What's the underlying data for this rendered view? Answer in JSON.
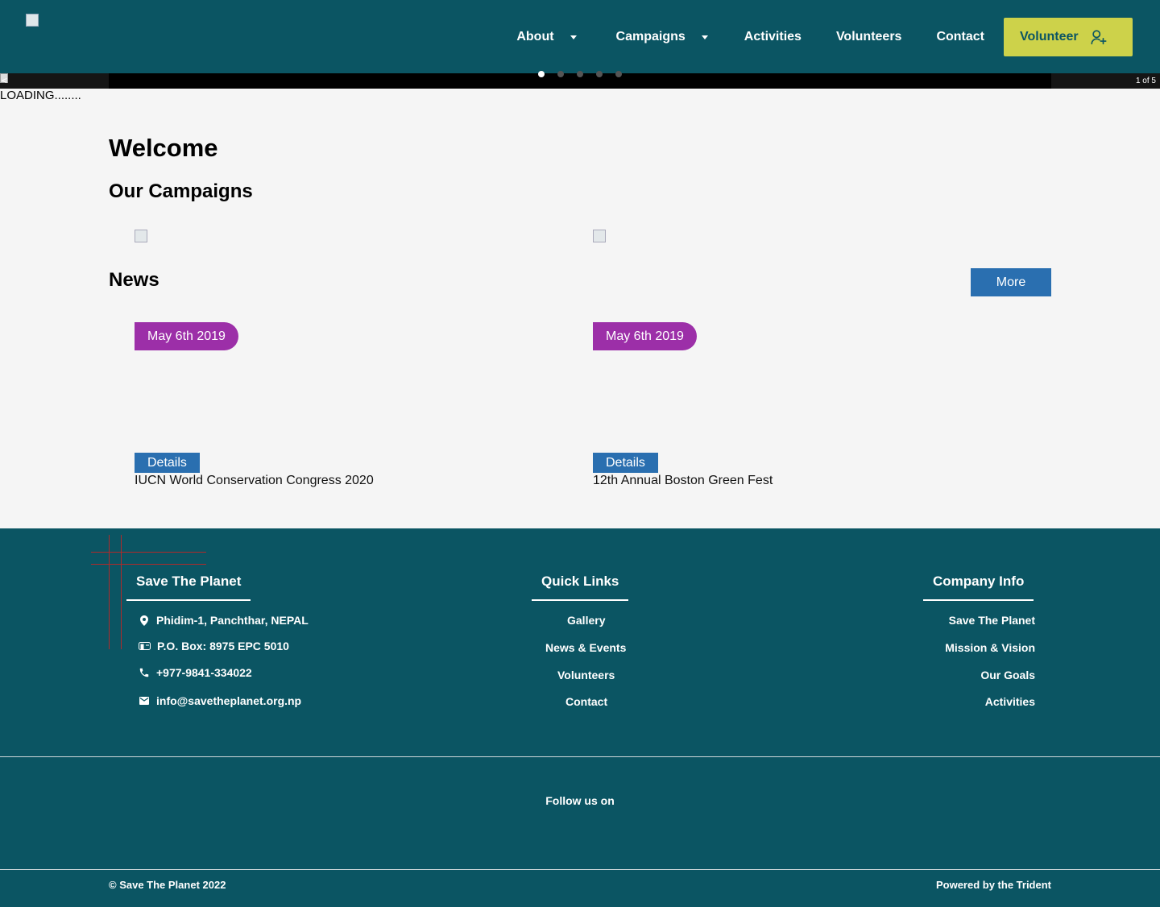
{
  "header": {
    "nav": {
      "about": "About",
      "campaigns": "Campaigns",
      "activities": "Activities",
      "volunteers": "Volunteers",
      "contact": "Contact"
    },
    "volunteer_button": "Volunteer",
    "colors": {
      "background": "#0b5563",
      "cta": "#cdd24a"
    }
  },
  "slider": {
    "counter": "1 of 5",
    "slide_count": 5,
    "active_slide": 1,
    "prev_glyph": "<",
    "loading_text": "LOADING........"
  },
  "main": {
    "welcome": "Welcome",
    "campaigns_title": "Our Campaigns",
    "news_title": "News",
    "more_button": "More",
    "news": [
      {
        "date": "May 6th 2019",
        "details_label": "Details",
        "title": "IUCN World Conservation Congress 2020"
      },
      {
        "date": "May 6th 2019",
        "details_label": "Details",
        "title": "12th Annual Boston Green Fest"
      }
    ],
    "colors": {
      "date_badge": "#9c2fa8",
      "button": "#2a6fb0"
    }
  },
  "footer": {
    "org_title": "Save The Planet",
    "address": "Phidim-1, Panchthar, NEPAL",
    "po_box": "P.O. Box: 8975 EPC 5010",
    "phone": "+977-9841-334022",
    "email": "info@savetheplanet.org.np",
    "quick_links_title": "Quick Links",
    "quick_links": [
      "Gallery",
      "News & Events",
      "Volunteers",
      "Contact"
    ],
    "company_info_title": "Company Info",
    "company_links": [
      "Save The Planet",
      "Mission & Vision",
      "Our Goals",
      "Activities"
    ],
    "follow_us": "Follow us on",
    "copyright": "© Save The Planet 2022",
    "powered_by": "Powered by the Trident"
  }
}
